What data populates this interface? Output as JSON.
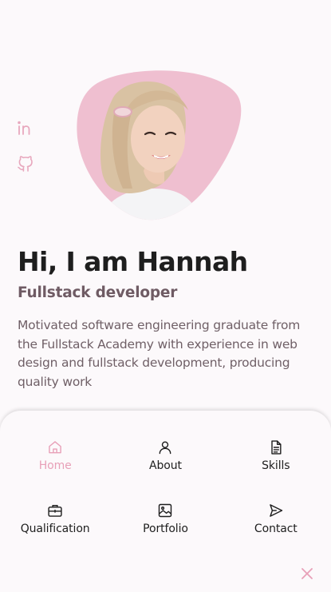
{
  "accent_color": "#e8a0b8",
  "social": [
    {
      "icon": "linkedin-icon"
    },
    {
      "icon": "github-icon"
    }
  ],
  "avatar": {
    "icon": "avatar-photo",
    "bg_color": "#efbfd0"
  },
  "hero": {
    "title": "Hi, I am Hannah",
    "subtitle": "Fullstack developer",
    "description": "Motivated software engineering graduate from the Fullstack Academy with experience in web design and fullstack development, producing quality work"
  },
  "nav": {
    "items": [
      {
        "label": "Home",
        "icon": "home-icon",
        "active": true
      },
      {
        "label": "About",
        "icon": "user-icon",
        "active": false
      },
      {
        "label": "Skills",
        "icon": "file-icon",
        "active": false
      },
      {
        "label": "Qualification",
        "icon": "briefcase-icon",
        "active": false
      },
      {
        "label": "Portfolio",
        "icon": "image-icon",
        "active": false
      },
      {
        "label": "Contact",
        "icon": "send-icon",
        "active": false
      }
    ],
    "close_icon": "close-icon"
  }
}
